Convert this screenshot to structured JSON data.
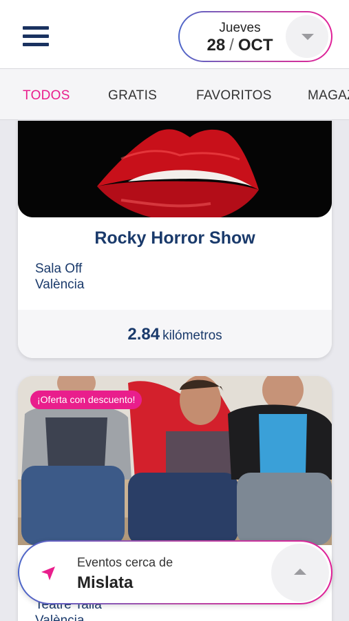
{
  "header": {
    "date": {
      "weekday": "Jueves",
      "day": "28",
      "separator": "/",
      "month": "OCT"
    }
  },
  "tabs": [
    {
      "label": "TODOS",
      "active": true
    },
    {
      "label": "GRATIS",
      "active": false
    },
    {
      "label": "FAVORITOS",
      "active": false
    },
    {
      "label": "MAGAZINE",
      "active": false
    }
  ],
  "events": [
    {
      "title": "Rocky Horror Show",
      "venue": "Sala Off",
      "city": "València",
      "distance": "2.84",
      "distance_unit": "kilómetros",
      "image": "red-lips"
    },
    {
      "badge": "¡Oferta con descuento!",
      "venue": "Teatre Talia",
      "city": "València",
      "image": "three-men-on-sofa"
    }
  ],
  "location": {
    "label": "Eventos cerca de",
    "city": "Mislata",
    "icon": "navigation-arrow-icon"
  },
  "colors": {
    "accent": "#e91e8c",
    "navy": "#1a3a6b",
    "gradient_start": "#4c67c9",
    "gradient_end": "#e01f97"
  }
}
